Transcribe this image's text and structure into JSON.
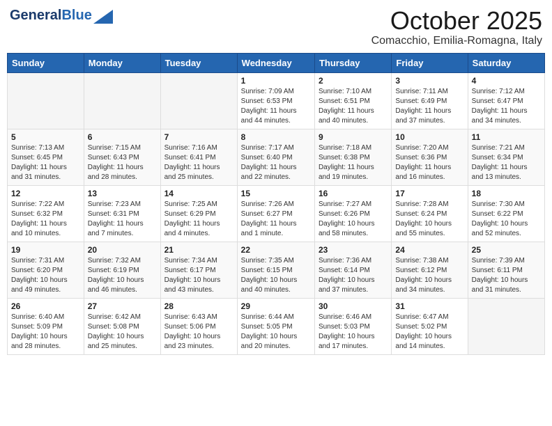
{
  "header": {
    "logo_line1": "General",
    "logo_line2": "Blue",
    "month": "October 2025",
    "location": "Comacchio, Emilia-Romagna, Italy"
  },
  "days_of_week": [
    "Sunday",
    "Monday",
    "Tuesday",
    "Wednesday",
    "Thursday",
    "Friday",
    "Saturday"
  ],
  "weeks": [
    [
      {
        "day": "",
        "content": ""
      },
      {
        "day": "",
        "content": ""
      },
      {
        "day": "",
        "content": ""
      },
      {
        "day": "1",
        "content": "Sunrise: 7:09 AM\nSunset: 6:53 PM\nDaylight: 11 hours\nand 44 minutes."
      },
      {
        "day": "2",
        "content": "Sunrise: 7:10 AM\nSunset: 6:51 PM\nDaylight: 11 hours\nand 40 minutes."
      },
      {
        "day": "3",
        "content": "Sunrise: 7:11 AM\nSunset: 6:49 PM\nDaylight: 11 hours\nand 37 minutes."
      },
      {
        "day": "4",
        "content": "Sunrise: 7:12 AM\nSunset: 6:47 PM\nDaylight: 11 hours\nand 34 minutes."
      }
    ],
    [
      {
        "day": "5",
        "content": "Sunrise: 7:13 AM\nSunset: 6:45 PM\nDaylight: 11 hours\nand 31 minutes."
      },
      {
        "day": "6",
        "content": "Sunrise: 7:15 AM\nSunset: 6:43 PM\nDaylight: 11 hours\nand 28 minutes."
      },
      {
        "day": "7",
        "content": "Sunrise: 7:16 AM\nSunset: 6:41 PM\nDaylight: 11 hours\nand 25 minutes."
      },
      {
        "day": "8",
        "content": "Sunrise: 7:17 AM\nSunset: 6:40 PM\nDaylight: 11 hours\nand 22 minutes."
      },
      {
        "day": "9",
        "content": "Sunrise: 7:18 AM\nSunset: 6:38 PM\nDaylight: 11 hours\nand 19 minutes."
      },
      {
        "day": "10",
        "content": "Sunrise: 7:20 AM\nSunset: 6:36 PM\nDaylight: 11 hours\nand 16 minutes."
      },
      {
        "day": "11",
        "content": "Sunrise: 7:21 AM\nSunset: 6:34 PM\nDaylight: 11 hours\nand 13 minutes."
      }
    ],
    [
      {
        "day": "12",
        "content": "Sunrise: 7:22 AM\nSunset: 6:32 PM\nDaylight: 11 hours\nand 10 minutes."
      },
      {
        "day": "13",
        "content": "Sunrise: 7:23 AM\nSunset: 6:31 PM\nDaylight: 11 hours\nand 7 minutes."
      },
      {
        "day": "14",
        "content": "Sunrise: 7:25 AM\nSunset: 6:29 PM\nDaylight: 11 hours\nand 4 minutes."
      },
      {
        "day": "15",
        "content": "Sunrise: 7:26 AM\nSunset: 6:27 PM\nDaylight: 11 hours\nand 1 minute."
      },
      {
        "day": "16",
        "content": "Sunrise: 7:27 AM\nSunset: 6:26 PM\nDaylight: 10 hours\nand 58 minutes."
      },
      {
        "day": "17",
        "content": "Sunrise: 7:28 AM\nSunset: 6:24 PM\nDaylight: 10 hours\nand 55 minutes."
      },
      {
        "day": "18",
        "content": "Sunrise: 7:30 AM\nSunset: 6:22 PM\nDaylight: 10 hours\nand 52 minutes."
      }
    ],
    [
      {
        "day": "19",
        "content": "Sunrise: 7:31 AM\nSunset: 6:20 PM\nDaylight: 10 hours\nand 49 minutes."
      },
      {
        "day": "20",
        "content": "Sunrise: 7:32 AM\nSunset: 6:19 PM\nDaylight: 10 hours\nand 46 minutes."
      },
      {
        "day": "21",
        "content": "Sunrise: 7:34 AM\nSunset: 6:17 PM\nDaylight: 10 hours\nand 43 minutes."
      },
      {
        "day": "22",
        "content": "Sunrise: 7:35 AM\nSunset: 6:15 PM\nDaylight: 10 hours\nand 40 minutes."
      },
      {
        "day": "23",
        "content": "Sunrise: 7:36 AM\nSunset: 6:14 PM\nDaylight: 10 hours\nand 37 minutes."
      },
      {
        "day": "24",
        "content": "Sunrise: 7:38 AM\nSunset: 6:12 PM\nDaylight: 10 hours\nand 34 minutes."
      },
      {
        "day": "25",
        "content": "Sunrise: 7:39 AM\nSunset: 6:11 PM\nDaylight: 10 hours\nand 31 minutes."
      }
    ],
    [
      {
        "day": "26",
        "content": "Sunrise: 6:40 AM\nSunset: 5:09 PM\nDaylight: 10 hours\nand 28 minutes."
      },
      {
        "day": "27",
        "content": "Sunrise: 6:42 AM\nSunset: 5:08 PM\nDaylight: 10 hours\nand 25 minutes."
      },
      {
        "day": "28",
        "content": "Sunrise: 6:43 AM\nSunset: 5:06 PM\nDaylight: 10 hours\nand 23 minutes."
      },
      {
        "day": "29",
        "content": "Sunrise: 6:44 AM\nSunset: 5:05 PM\nDaylight: 10 hours\nand 20 minutes."
      },
      {
        "day": "30",
        "content": "Sunrise: 6:46 AM\nSunset: 5:03 PM\nDaylight: 10 hours\nand 17 minutes."
      },
      {
        "day": "31",
        "content": "Sunrise: 6:47 AM\nSunset: 5:02 PM\nDaylight: 10 hours\nand 14 minutes."
      },
      {
        "day": "",
        "content": ""
      }
    ]
  ]
}
